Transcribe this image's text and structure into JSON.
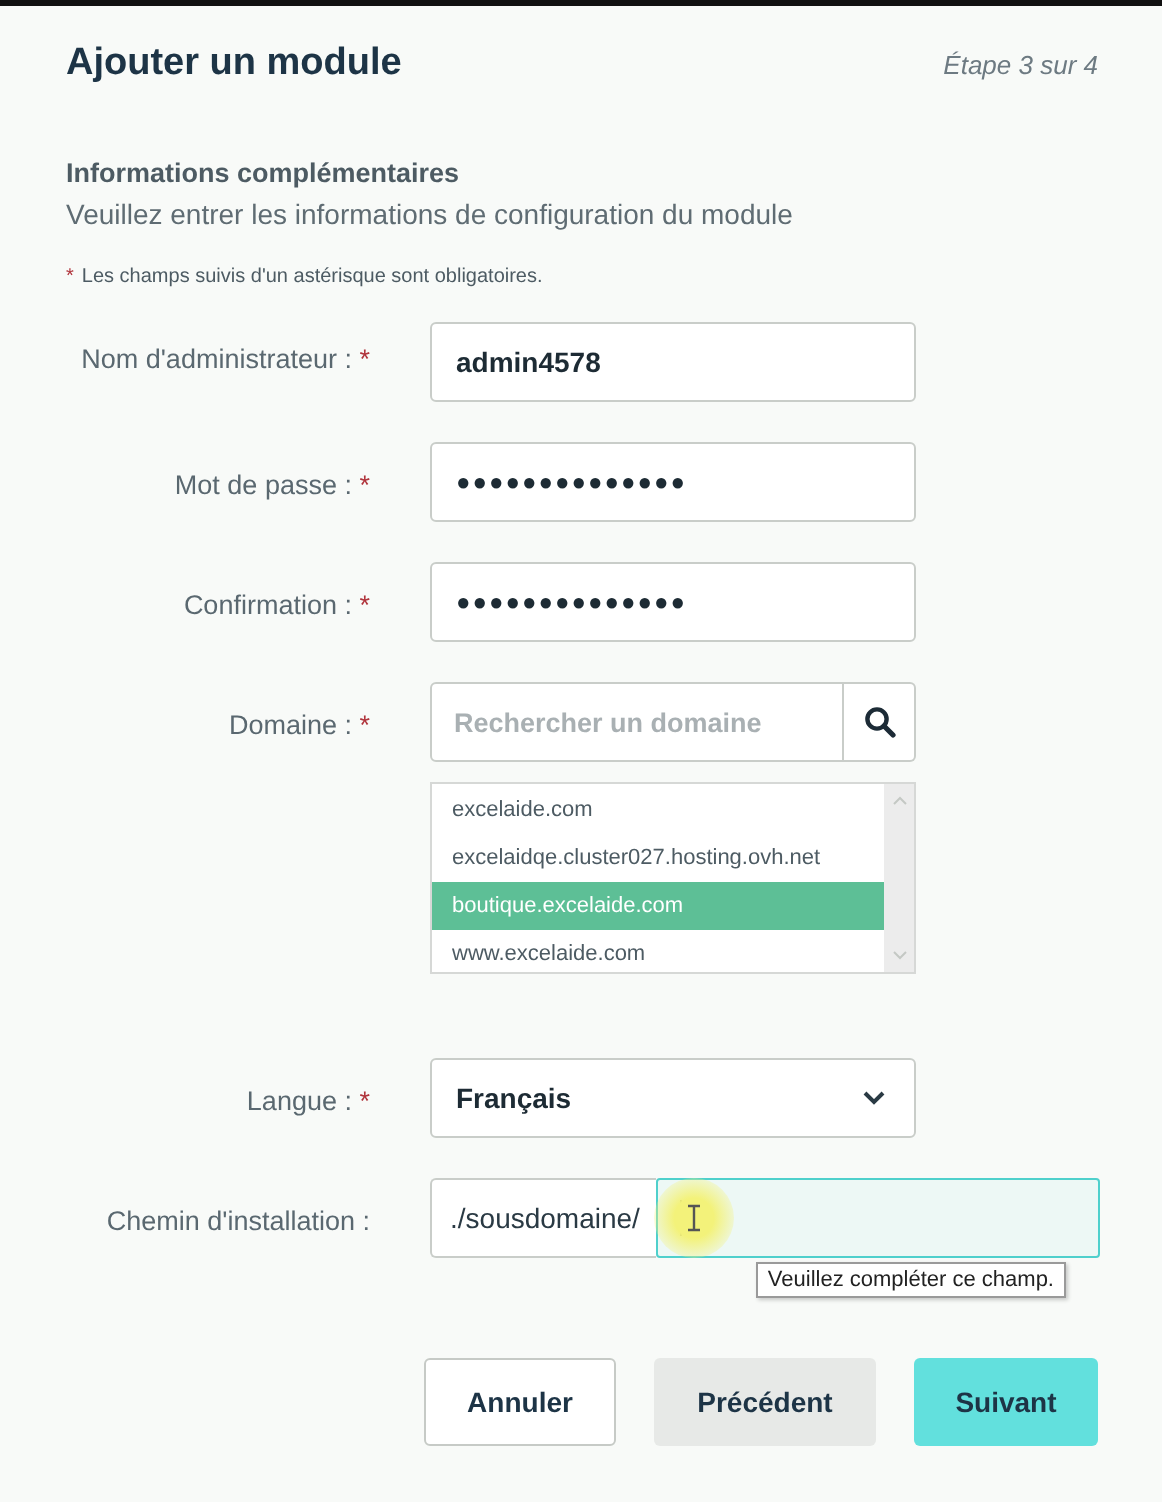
{
  "header": {
    "title": "Ajouter un module",
    "step": "Étape 3 sur 4"
  },
  "section": {
    "title": "Informations complémentaires",
    "description": "Veuillez entrer les informations de configuration du module"
  },
  "required_note": {
    "mark": "*",
    "text": "Les champs suivis d'un astérisque sont obligatoires."
  },
  "fields": [
    {
      "kind": "text",
      "label": "Nom d'administrateur :",
      "required": true,
      "value": "admin4578"
    },
    {
      "kind": "password",
      "label": "Mot de passe :",
      "required": true,
      "value": "●●●●●●●●●●●●●●"
    },
    {
      "kind": "password",
      "label": "Confirmation :",
      "required": true,
      "value": "●●●●●●●●●●●●●●"
    },
    {
      "kind": "search",
      "label": "Domaine :",
      "required": true,
      "placeholder": "Rechercher un domaine",
      "options": [
        {
          "label": "excelaide.com",
          "selected": false
        },
        {
          "label": "excelaidqe.cluster027.hosting.ovh.net",
          "selected": false
        },
        {
          "label": "boutique.excelaide.com",
          "selected": true
        },
        {
          "label": "www.excelaide.com",
          "selected": false
        }
      ]
    },
    {
      "kind": "select",
      "label": "Langue :",
      "required": true,
      "value": "Français"
    },
    {
      "kind": "path",
      "label": "Chemin d'installation :",
      "required": false,
      "prefix": "./sousdomaine/",
      "tooltip": "Veuillez compléter ce champ."
    }
  ],
  "buttons": [
    {
      "label": "Annuler",
      "kind": "outline"
    },
    {
      "label": "Précédent",
      "kind": "secondary"
    },
    {
      "label": "Suivant",
      "kind": "primary"
    }
  ]
}
